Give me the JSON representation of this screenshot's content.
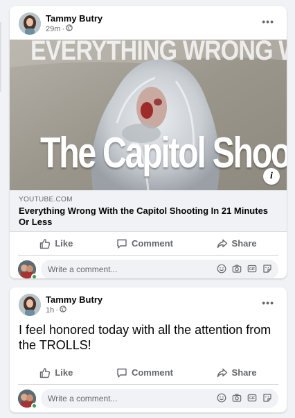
{
  "posts": [
    {
      "author": "Tammy Butry",
      "time": "29m",
      "privacy_icon": "globe-icon",
      "more_label": "•••",
      "link": {
        "thumb_top_text": "EVERYTHING WRONG WITH",
        "thumb_bottom_text": "The Capitol Shooting",
        "domain": "YOUTUBE.COM",
        "title": "Everything Wrong With the Capitol Shooting In 21 Minutes Or Less",
        "info_label": "i"
      }
    },
    {
      "author": "Tammy Butry",
      "time": "1h",
      "privacy_icon": "globe-icon",
      "more_label": "•••",
      "text": "I feel honored today with all the attention from the TROLLS!"
    }
  ],
  "actions": {
    "like": "Like",
    "comment": "Comment",
    "share": "Share"
  },
  "comment_box": {
    "placeholder": "Write a comment..."
  },
  "colors": {
    "page_bg": "#f0f2f5",
    "secondary_text": "#65676b",
    "online": "#31a24c"
  }
}
